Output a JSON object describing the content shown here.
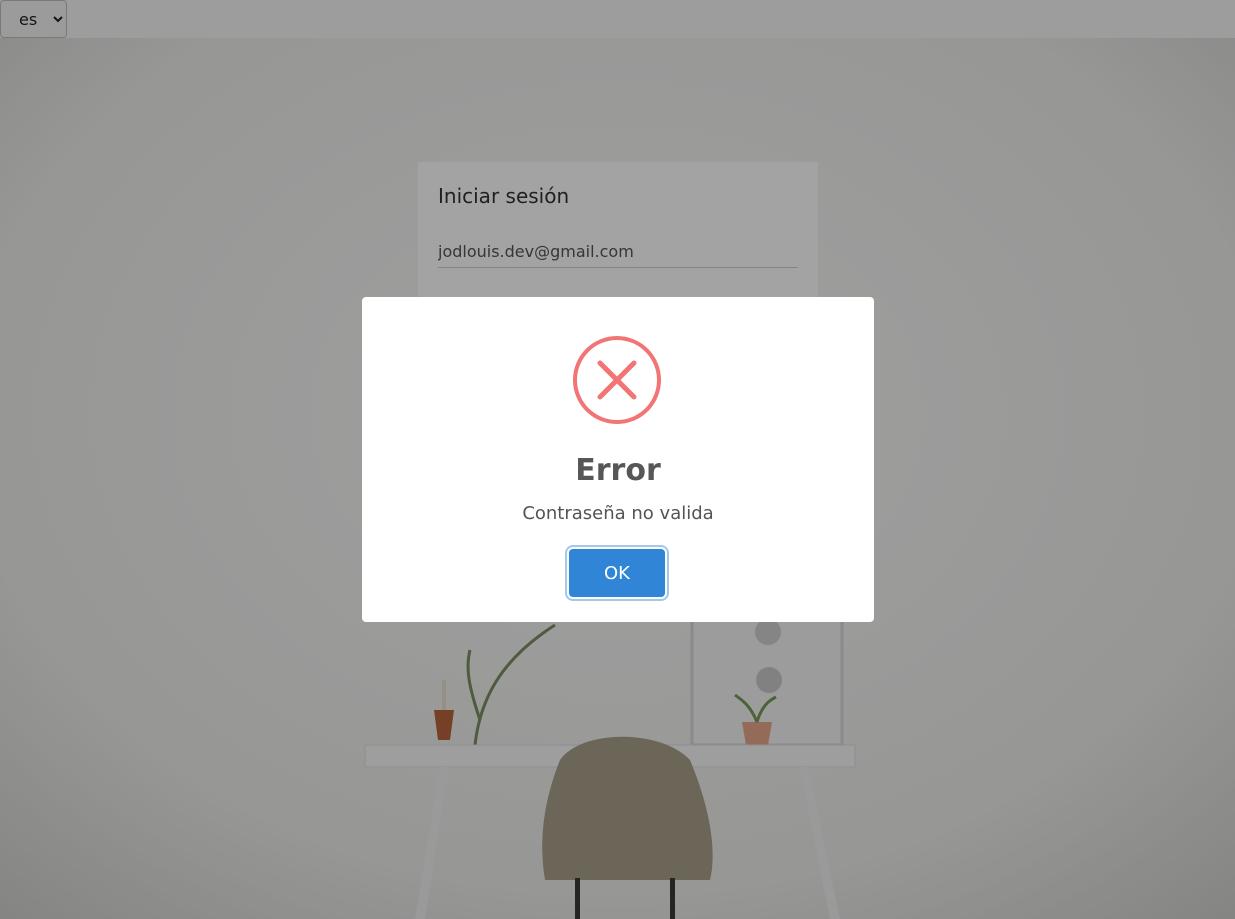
{
  "language_select": {
    "value": "es",
    "options": [
      "es"
    ]
  },
  "login": {
    "title": "Iniciar sesión",
    "email_value": "jodlouis.dev@gmail.com"
  },
  "dialog": {
    "icon": "error-x-icon",
    "title": "Error",
    "message": "Contraseña no valida",
    "ok_label": "OK"
  },
  "colors": {
    "error_icon": "#f27474",
    "ok_button": "#3085d6",
    "overlay": "rgba(0,0,0,0.36)"
  }
}
